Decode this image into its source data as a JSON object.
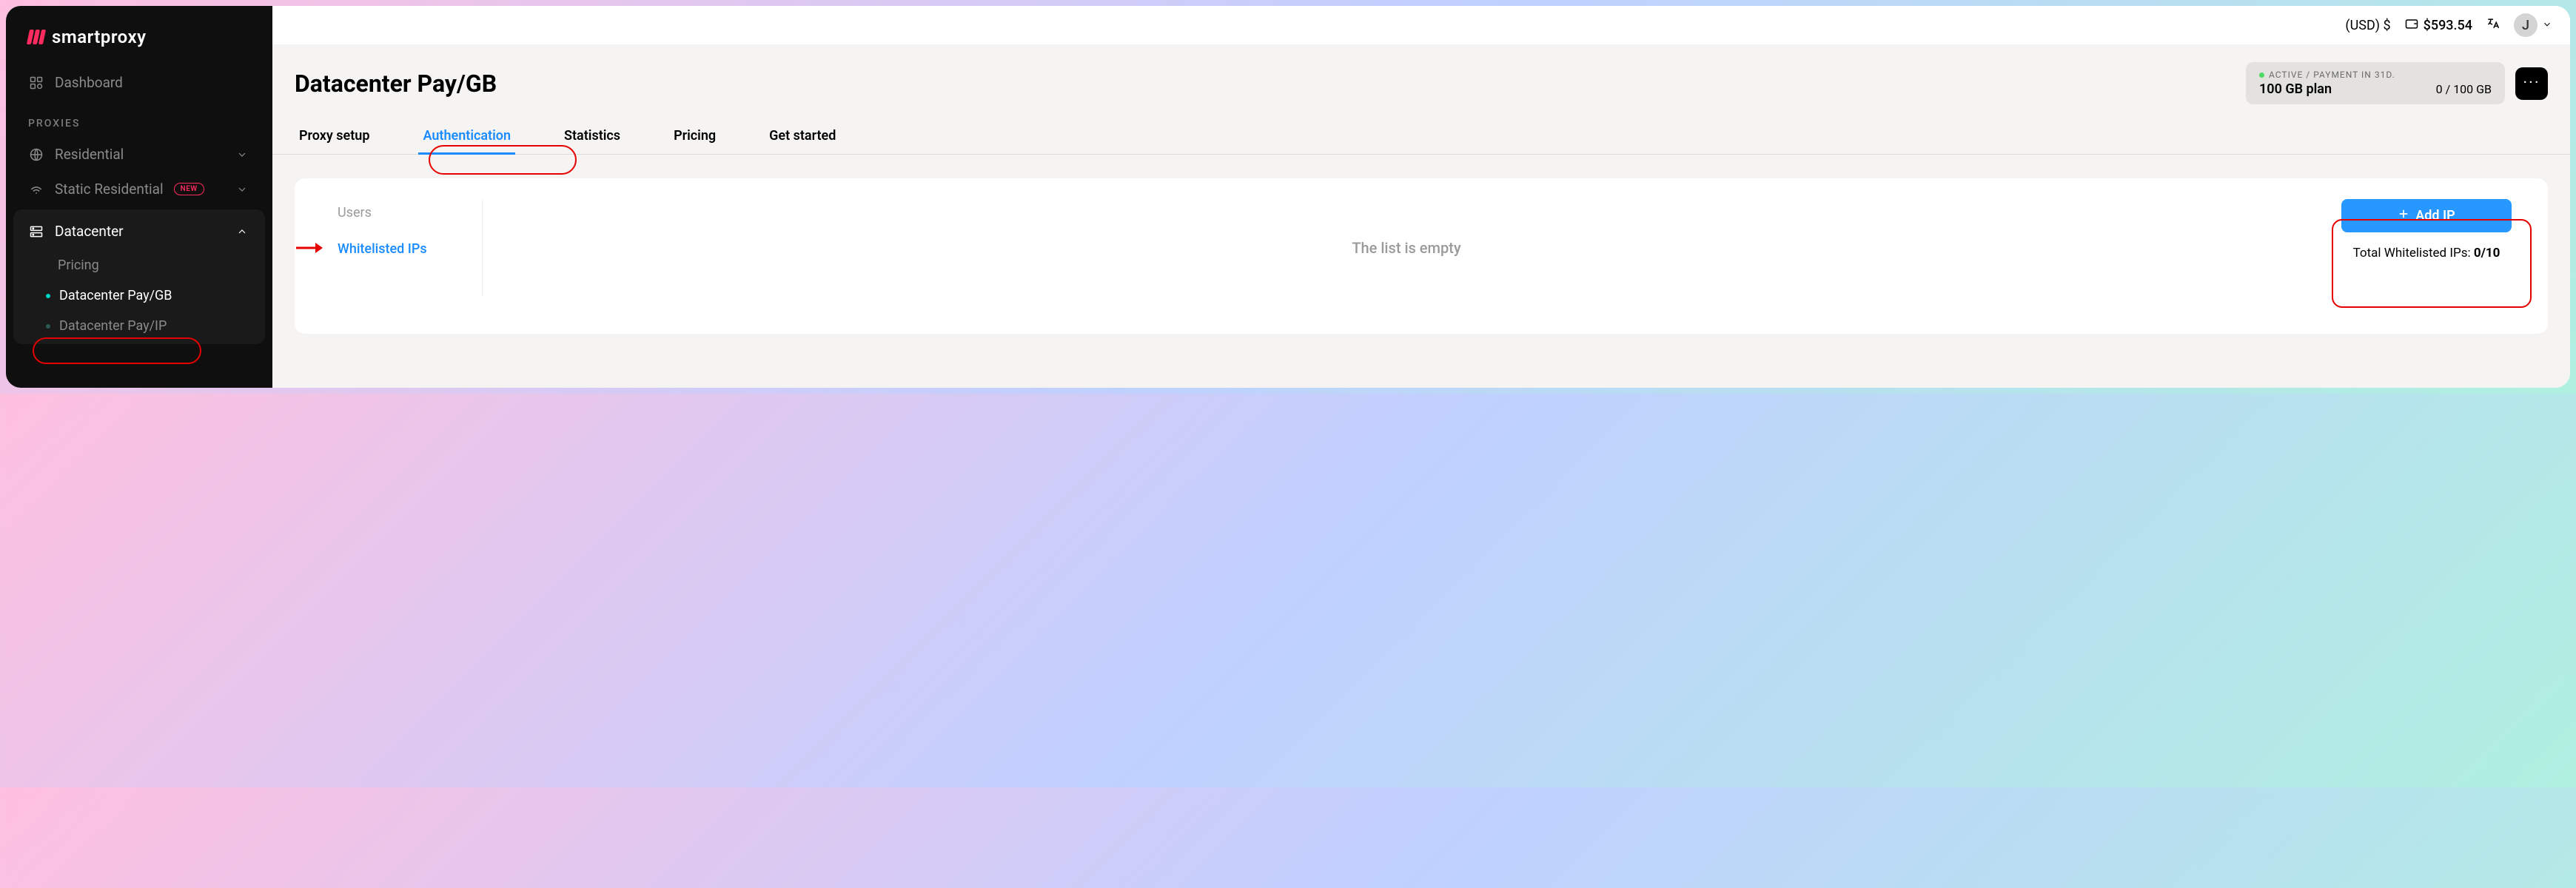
{
  "brand": "smartproxy",
  "sidebar": {
    "dashboard": "Dashboard",
    "section_proxies": "PROXIES",
    "residential": "Residential",
    "static_residential": "Static Residential",
    "new_badge": "NEW",
    "datacenter": "Datacenter",
    "sub": {
      "pricing": "Pricing",
      "paygb": "Datacenter Pay/GB",
      "payip": "Datacenter Pay/IP"
    }
  },
  "topbar": {
    "currency": "(USD) $",
    "balance": "$593.54",
    "avatar": "J"
  },
  "page": {
    "title": "Datacenter Pay/GB",
    "plan_status": "ACTIVE / PAYMENT IN 31D.",
    "plan_name": "100 GB plan",
    "plan_usage": "0 / 100 GB"
  },
  "tabs": {
    "proxy_setup": "Proxy setup",
    "authentication": "Authentication",
    "statistics": "Statistics",
    "pricing": "Pricing",
    "get_started": "Get started"
  },
  "auth": {
    "users_tab": "Users",
    "whitelist_tab": "Whitelisted IPs",
    "empty": "The list is empty",
    "add_ip": "Add IP",
    "total_label": "Total Whitelisted IPs: ",
    "total_count": "0/10"
  }
}
